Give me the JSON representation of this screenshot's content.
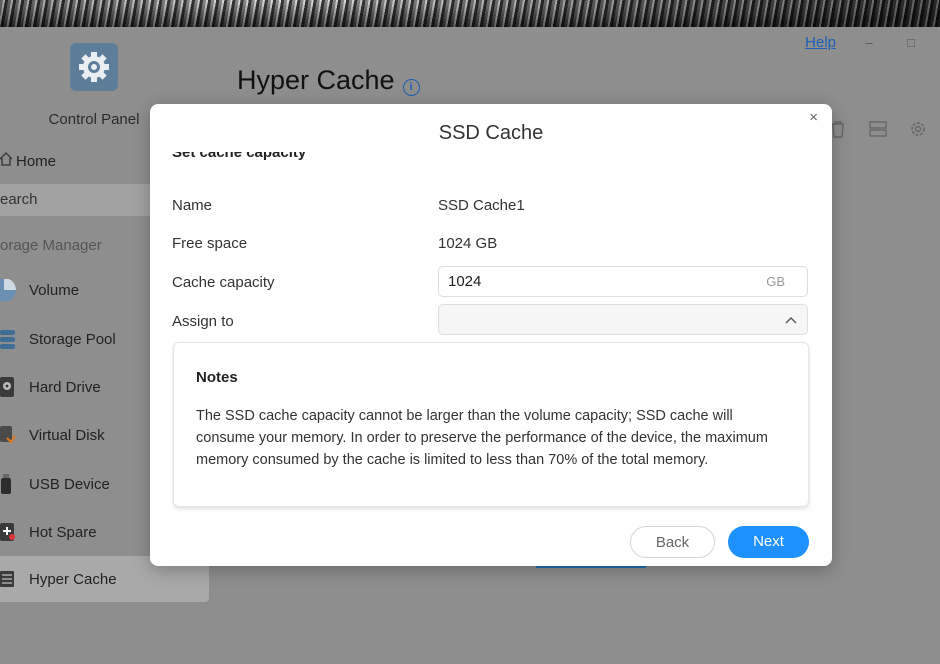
{
  "window": {
    "help_label": "Help",
    "minimize_glyph": "–",
    "maximize_glyph": "□"
  },
  "sidebar": {
    "app_label": "Control Panel",
    "home_label": "Home",
    "search_placeholder": "earch",
    "section_label": "orage Manager",
    "items": [
      {
        "label": "Volume",
        "icon": "pie-chart-icon"
      },
      {
        "label": "Storage Pool",
        "icon": "storage-pool-icon"
      },
      {
        "label": "Hard Drive",
        "icon": "hard-drive-icon"
      },
      {
        "label": "Virtual Disk",
        "icon": "virtual-disk-icon"
      },
      {
        "label": "USB Device",
        "icon": "usb-icon"
      },
      {
        "label": "Hot Spare",
        "icon": "hot-spare-icon"
      },
      {
        "label": "Hyper Cache",
        "icon": "hyper-cache-icon"
      }
    ],
    "active_item": "Hyper Cache"
  },
  "main": {
    "title": "Hyper Cache",
    "info_glyph": "i"
  },
  "modal": {
    "title": "SSD Cache",
    "close_glyph": "×",
    "section_heading": "Set cache capacity",
    "fields": {
      "name_label": "Name",
      "name_value": "SSD Cache1",
      "free_space_label": "Free space",
      "free_space_value": "1024 GB",
      "cache_capacity_label": "Cache capacity",
      "cache_capacity_value": "1024",
      "cache_capacity_unit": "GB",
      "assign_to_label": "Assign to",
      "assign_to_value": ""
    },
    "notes": {
      "title": "Notes",
      "text": "The SSD cache capacity cannot be larger than the volume capacity; SSD cache will consume your memory. In order to preserve the performance of the device, the maximum memory consumed by the cache is limited to less than 70% of the total memory."
    },
    "buttons": {
      "back": "Back",
      "next": "Next"
    }
  },
  "colors": {
    "accent": "#1e90ff",
    "link": "#1d5fb5",
    "overlay": "#8e8e8e"
  }
}
